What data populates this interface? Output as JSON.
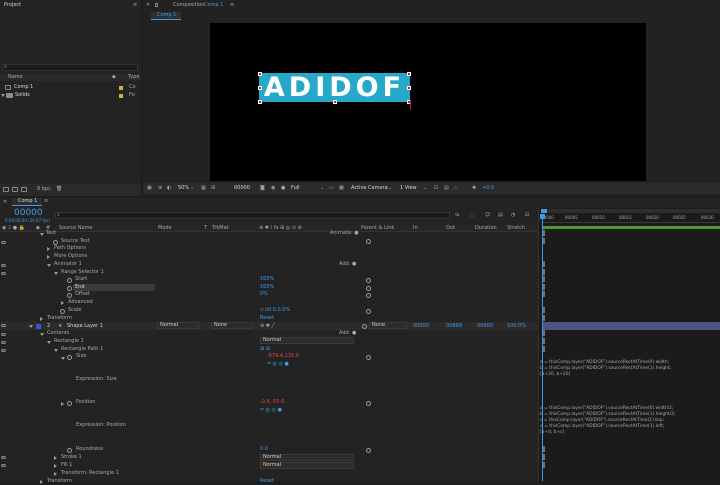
{
  "project": {
    "title": "Project",
    "search_placeholder": "",
    "col_name": "Name",
    "col_type": "Type",
    "items": [
      {
        "name": "Comp 1",
        "type": "Co"
      },
      {
        "name": "Solids",
        "type": "Fo"
      }
    ],
    "bpc": "8 bpc"
  },
  "viewer": {
    "title": "Composition",
    "title_comp": "Comp 1",
    "tab": "Comp 1",
    "logo_text": "ADIDOF",
    "zoom": "50%",
    "timecode": "00000",
    "resolution": "Full",
    "camera": "Active Camera",
    "views": "1 View",
    "exposure": "+0.0",
    "accent": "#26a8c8"
  },
  "timeline": {
    "tab": "Comp 1",
    "timecode": "00000",
    "timecode_sub": "0;00;00;00 (29.97 fps)",
    "search_placeholder": "",
    "cols": {
      "num": "#",
      "source": "Source Name",
      "mode": "Mode",
      "t": "T",
      "trkmat": "TrkMat",
      "switches": "⊕ ✱ \\ fx ⊞ ◎ ⊙ ⊛",
      "parent": "Parent & Link",
      "in": "In",
      "out": "Out",
      "duration": "Duration",
      "stretch": "Stretch"
    },
    "rows": [
      {
        "label": "Text",
        "value": "Animate: ●"
      },
      {
        "label": "Source Text"
      },
      {
        "label": "Path Options"
      },
      {
        "label": "More Options"
      },
      {
        "label": "Animator 1",
        "value": "Add: ●"
      },
      {
        "label": "Range Selector 1"
      },
      {
        "label": "Start",
        "value": "100%"
      },
      {
        "label": "End",
        "value": "100%"
      },
      {
        "label": "Offset",
        "value": "0%"
      },
      {
        "label": "Advanced"
      },
      {
        "label": "Scale",
        "value": "0.0,0.0%"
      },
      {
        "label": "Transform",
        "value": "Reset"
      },
      {
        "num": "2",
        "label": "Shape Layer 1",
        "mode": "Normal",
        "trkmat": "None",
        "parent": "None",
        "in": "00000",
        "out": "00899",
        "duration": "00900",
        "stretch": "100.0%"
      },
      {
        "label": "Contents",
        "value": "Add: ●"
      },
      {
        "label": "Rectangle 1",
        "value": "Normal"
      },
      {
        "label": "Rectangle Path 1",
        "value": "⊞ ⊞"
      },
      {
        "label": "Size",
        "value": "-674.4,135.0"
      },
      {
        "label": "Expression: Size"
      },
      {
        "label": "Position",
        "value": "-0.6,-55.6"
      },
      {
        "label": "Expression: Position"
      },
      {
        "label": "Roundness",
        "value": "0.0"
      },
      {
        "label": "Stroke 1",
        "value": "Normal"
      },
      {
        "label": "Fill 1",
        "value": "Normal"
      },
      {
        "label": "Transform: Rectangle 1"
      },
      {
        "label": "Transform",
        "value": "Reset"
      }
    ],
    "ruler": [
      "00000",
      "00005",
      "00010",
      "00015",
      "00020",
      "00025",
      "00030"
    ],
    "expr_size": [
      "a = thisComp.layer(\"ADIDOF\").sourceRectAtTime(0).width;",
      "b = thisComp.layer(\"ADIDOF\").sourceRectAtTime(1).height;",
      "[a+20, b+20]"
    ],
    "expr_pos": [
      "a = thisComp.layer(\"ADIDOF\").sourceRectAtTime(0).width/2;",
      "b = thisComp.layer(\"ADIDOF\").sourceRectAtTime(1).height/2;",
      "c = thisComp.layer(\"ADIDOF\").sourceRectAtTime(1).top;",
      "d = thisComp.layer(\"ADIDOF\").sourceRectAtTime(1).left;",
      "[a+d, b+c]"
    ]
  }
}
